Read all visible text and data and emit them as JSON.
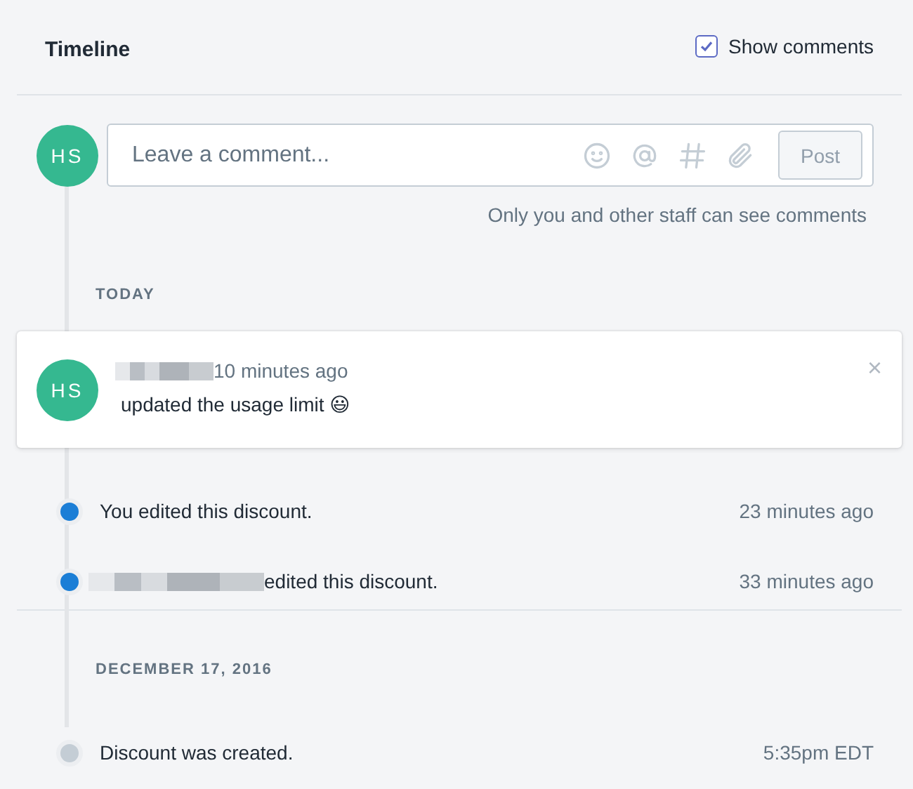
{
  "header": {
    "title": "Timeline",
    "show_comments": {
      "label": "Show comments",
      "checked": true
    }
  },
  "composer": {
    "avatar": "HS",
    "placeholder": "Leave a comment...",
    "post_button": "Post",
    "note": "Only you and other staff can see comments"
  },
  "sections": [
    {
      "label": "TODAY",
      "comment": {
        "avatar": "HS",
        "author_redacted": true,
        "time": "10 minutes ago",
        "text": "updated the usage limit 😃",
        "close": "×"
      },
      "events": [
        {
          "actor_redacted": false,
          "text": "You edited this discount.",
          "time": "23 minutes ago",
          "color": "#1b7ed6"
        },
        {
          "actor_redacted": true,
          "text": "edited this discount.",
          "time": "33 minutes ago",
          "color": "#1b7ed6"
        }
      ]
    },
    {
      "label": "DECEMBER 17, 2016",
      "events": [
        {
          "actor_redacted": false,
          "text": "Discount was created.",
          "time": "5:35pm EDT",
          "color": "#c4cdd5"
        }
      ]
    }
  ]
}
